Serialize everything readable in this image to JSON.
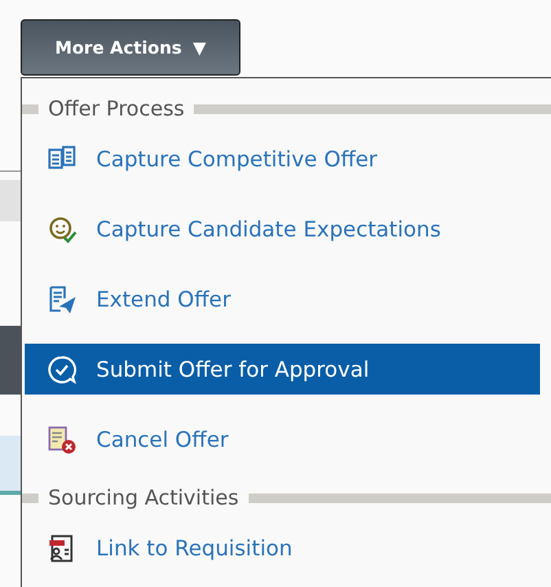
{
  "button": {
    "label": "More Actions",
    "caret": "▼",
    "expanded": true
  },
  "menu": [
    {
      "kind": "header",
      "label": "Offer Process"
    },
    {
      "kind": "action",
      "label": "Capture Competitive Offer",
      "selected": false
    },
    {
      "kind": "action",
      "label": "Capture Candidate Expectations",
      "selected": false
    },
    {
      "kind": "action",
      "label": "Extend Offer",
      "selected": false
    },
    {
      "kind": "action",
      "label": "Submit Offer for Approval",
      "selected": true
    },
    {
      "kind": "action",
      "label": "Cancel Offer",
      "selected": false
    },
    {
      "kind": "header",
      "label": "Sourcing Activities"
    },
    {
      "kind": "action",
      "label": "Link to Requisition",
      "selected": false
    }
  ]
}
